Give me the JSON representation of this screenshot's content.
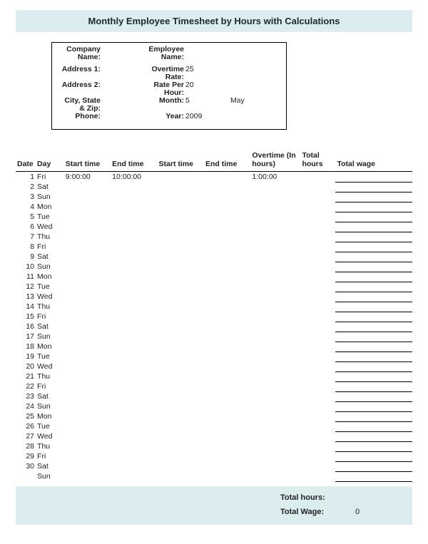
{
  "title": "Monthly Employee Timesheet by Hours with Calculations",
  "info": {
    "company_label": "Company Name:",
    "company_value": "",
    "employee_label": "Employee Name:",
    "employee_value": "",
    "address1_label": "Address 1:",
    "address1_value": "",
    "overtime_rate_label": "Overtime Rate:",
    "overtime_rate_value": "25",
    "address2_label": "Address 2:",
    "address2_value": "",
    "rate_per_hour_label": "Rate Per Hour:",
    "rate_per_hour_value": "20",
    "csz_label": "City, State & Zip:",
    "csz_value": "",
    "month_label": "Month:",
    "month_value": "5",
    "month_name": "May",
    "phone_label": "Phone:",
    "phone_value": "",
    "year_label": "Year:",
    "year_value": "2009"
  },
  "columns": {
    "date": "Date",
    "day": "Day",
    "start1": "Start time",
    "end1": "End time",
    "start2": "Start time",
    "end2": "End time",
    "overtime": "Overtime (In hours)",
    "total_hours": "Total hours",
    "total_wage": "Total wage"
  },
  "rows": [
    {
      "date": "1",
      "day": "Fri",
      "start1": "9:00:00",
      "end1": "10:00:00",
      "start2": "",
      "end2": "",
      "overtime": "1:00:00",
      "total_hours": "",
      "total_wage": ""
    },
    {
      "date": "2",
      "day": "Sat",
      "start1": "",
      "end1": "",
      "start2": "",
      "end2": "",
      "overtime": "",
      "total_hours": "",
      "total_wage": ""
    },
    {
      "date": "3",
      "day": "Sun",
      "start1": "",
      "end1": "",
      "start2": "",
      "end2": "",
      "overtime": "",
      "total_hours": "",
      "total_wage": ""
    },
    {
      "date": "4",
      "day": "Mon",
      "start1": "",
      "end1": "",
      "start2": "",
      "end2": "",
      "overtime": "",
      "total_hours": "",
      "total_wage": ""
    },
    {
      "date": "5",
      "day": "Tue",
      "start1": "",
      "end1": "",
      "start2": "",
      "end2": "",
      "overtime": "",
      "total_hours": "",
      "total_wage": ""
    },
    {
      "date": "6",
      "day": "Wed",
      "start1": "",
      "end1": "",
      "start2": "",
      "end2": "",
      "overtime": "",
      "total_hours": "",
      "total_wage": ""
    },
    {
      "date": "7",
      "day": "Thu",
      "start1": "",
      "end1": "",
      "start2": "",
      "end2": "",
      "overtime": "",
      "total_hours": "",
      "total_wage": ""
    },
    {
      "date": "8",
      "day": "Fri",
      "start1": "",
      "end1": "",
      "start2": "",
      "end2": "",
      "overtime": "",
      "total_hours": "",
      "total_wage": ""
    },
    {
      "date": "9",
      "day": "Sat",
      "start1": "",
      "end1": "",
      "start2": "",
      "end2": "",
      "overtime": "",
      "total_hours": "",
      "total_wage": ""
    },
    {
      "date": "10",
      "day": "Sun",
      "start1": "",
      "end1": "",
      "start2": "",
      "end2": "",
      "overtime": "",
      "total_hours": "",
      "total_wage": ""
    },
    {
      "date": "11",
      "day": "Mon",
      "start1": "",
      "end1": "",
      "start2": "",
      "end2": "",
      "overtime": "",
      "total_hours": "",
      "total_wage": ""
    },
    {
      "date": "12",
      "day": "Tue",
      "start1": "",
      "end1": "",
      "start2": "",
      "end2": "",
      "overtime": "",
      "total_hours": "",
      "total_wage": ""
    },
    {
      "date": "13",
      "day": "Wed",
      "start1": "",
      "end1": "",
      "start2": "",
      "end2": "",
      "overtime": "",
      "total_hours": "",
      "total_wage": ""
    },
    {
      "date": "14",
      "day": "Thu",
      "start1": "",
      "end1": "",
      "start2": "",
      "end2": "",
      "overtime": "",
      "total_hours": "",
      "total_wage": ""
    },
    {
      "date": "15",
      "day": "Fri",
      "start1": "",
      "end1": "",
      "start2": "",
      "end2": "",
      "overtime": "",
      "total_hours": "",
      "total_wage": ""
    },
    {
      "date": "16",
      "day": "Sat",
      "start1": "",
      "end1": "",
      "start2": "",
      "end2": "",
      "overtime": "",
      "total_hours": "",
      "total_wage": ""
    },
    {
      "date": "17",
      "day": "Sun",
      "start1": "",
      "end1": "",
      "start2": "",
      "end2": "",
      "overtime": "",
      "total_hours": "",
      "total_wage": ""
    },
    {
      "date": "18",
      "day": "Mon",
      "start1": "",
      "end1": "",
      "start2": "",
      "end2": "",
      "overtime": "",
      "total_hours": "",
      "total_wage": ""
    },
    {
      "date": "19",
      "day": "Tue",
      "start1": "",
      "end1": "",
      "start2": "",
      "end2": "",
      "overtime": "",
      "total_hours": "",
      "total_wage": ""
    },
    {
      "date": "20",
      "day": "Wed",
      "start1": "",
      "end1": "",
      "start2": "",
      "end2": "",
      "overtime": "",
      "total_hours": "",
      "total_wage": ""
    },
    {
      "date": "21",
      "day": "Thu",
      "start1": "",
      "end1": "",
      "start2": "",
      "end2": "",
      "overtime": "",
      "total_hours": "",
      "total_wage": ""
    },
    {
      "date": "22",
      "day": "Fri",
      "start1": "",
      "end1": "",
      "start2": "",
      "end2": "",
      "overtime": "",
      "total_hours": "",
      "total_wage": ""
    },
    {
      "date": "23",
      "day": "Sat",
      "start1": "",
      "end1": "",
      "start2": "",
      "end2": "",
      "overtime": "",
      "total_hours": "",
      "total_wage": ""
    },
    {
      "date": "24",
      "day": "Sun",
      "start1": "",
      "end1": "",
      "start2": "",
      "end2": "",
      "overtime": "",
      "total_hours": "",
      "total_wage": ""
    },
    {
      "date": "25",
      "day": "Mon",
      "start1": "",
      "end1": "",
      "start2": "",
      "end2": "",
      "overtime": "",
      "total_hours": "",
      "total_wage": ""
    },
    {
      "date": "26",
      "day": "Tue",
      "start1": "",
      "end1": "",
      "start2": "",
      "end2": "",
      "overtime": "",
      "total_hours": "",
      "total_wage": ""
    },
    {
      "date": "27",
      "day": "Wed",
      "start1": "",
      "end1": "",
      "start2": "",
      "end2": "",
      "overtime": "",
      "total_hours": "",
      "total_wage": ""
    },
    {
      "date": "28",
      "day": "Thu",
      "start1": "",
      "end1": "",
      "start2": "",
      "end2": "",
      "overtime": "",
      "total_hours": "",
      "total_wage": ""
    },
    {
      "date": "29",
      "day": "Fri",
      "start1": "",
      "end1": "",
      "start2": "",
      "end2": "",
      "overtime": "",
      "total_hours": "",
      "total_wage": ""
    },
    {
      "date": "30",
      "day": "Sat",
      "start1": "",
      "end1": "",
      "start2": "",
      "end2": "",
      "overtime": "",
      "total_hours": "",
      "total_wage": ""
    },
    {
      "date": "",
      "day": "Sun",
      "start1": "",
      "end1": "",
      "start2": "",
      "end2": "",
      "overtime": "",
      "total_hours": "",
      "total_wage": ""
    }
  ],
  "totals": {
    "total_hours_label": "Total hours:",
    "total_hours_value": "",
    "total_wage_label": "Total Wage:",
    "total_wage_value": "0"
  }
}
